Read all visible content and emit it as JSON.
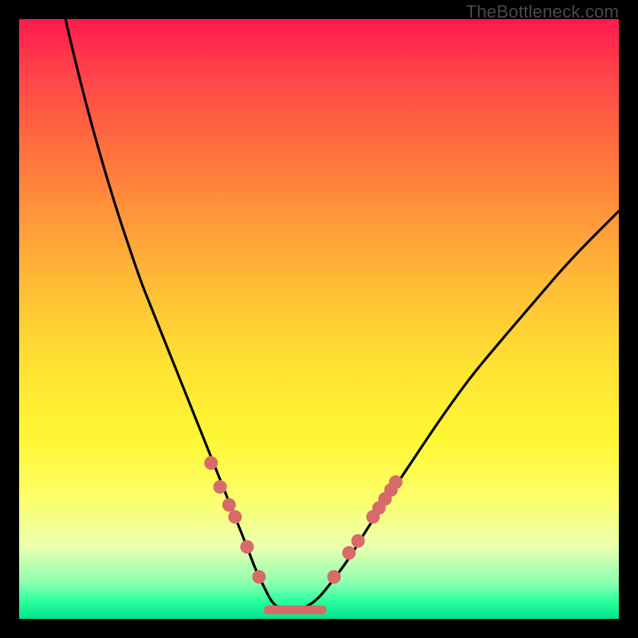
{
  "watermark": "TheBottleneck.com",
  "colors": {
    "curve": "#000000",
    "markers": "#d86a6a",
    "baseline": "#d86a6a"
  },
  "chart_data": {
    "type": "line",
    "title": "",
    "xlabel": "",
    "ylabel": "",
    "xlim": [
      0,
      100
    ],
    "ylim": [
      0,
      100
    ],
    "grid": false,
    "series": [
      {
        "name": "bottleneck-curve",
        "x": [
          0,
          5,
          10,
          15,
          20,
          22,
          24,
          26,
          28,
          30,
          32,
          34,
          36,
          38,
          39.5,
          41,
          42,
          43,
          44,
          46,
          48,
          50,
          52,
          55,
          58,
          62,
          66,
          70,
          75,
          80,
          86,
          92,
          100
        ],
        "y": [
          140,
          112,
          90,
          72,
          57,
          52,
          47,
          42,
          37,
          32,
          27,
          22,
          17,
          12,
          8,
          5,
          3,
          2,
          1.5,
          1.5,
          2,
          3.5,
          6,
          10,
          15,
          21,
          27,
          33,
          40,
          46,
          53,
          60,
          68
        ]
      }
    ],
    "markers": {
      "name": "highlight-points",
      "points": [
        {
          "x": 32.0,
          "y": 26
        },
        {
          "x": 33.5,
          "y": 22
        },
        {
          "x": 35.0,
          "y": 19
        },
        {
          "x": 36.0,
          "y": 17
        },
        {
          "x": 38.0,
          "y": 12
        },
        {
          "x": 40.0,
          "y": 7
        },
        {
          "x": 52.5,
          "y": 7
        },
        {
          "x": 55.0,
          "y": 11
        },
        {
          "x": 56.5,
          "y": 13
        },
        {
          "x": 59.0,
          "y": 17
        },
        {
          "x": 60.0,
          "y": 18.5
        },
        {
          "x": 61.0,
          "y": 20
        },
        {
          "x": 62.0,
          "y": 21.5
        },
        {
          "x": 62.8,
          "y": 22.8
        }
      ]
    },
    "baseline_segment": {
      "x0": 41.5,
      "x1": 50.5,
      "y": 1.5
    }
  }
}
